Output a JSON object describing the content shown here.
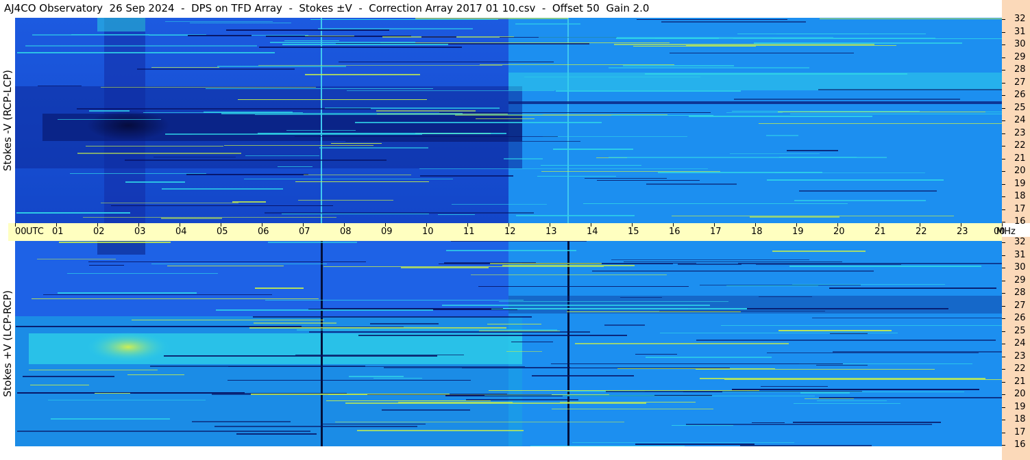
{
  "header": {
    "title": "AJ4CO Observatory  26 Sep 2024  -  DPS on TFD Array  -  Stokes ±V  -  Correction Array 2017 01 10.csv  -  Offset 50  Gain 2.0"
  },
  "panels": {
    "top_label": "Stokes -V (RCP-LCP)",
    "bottom_label": "Stokes +V (LCP-RCP)"
  },
  "colors": {
    "background_low": "#061060",
    "background_mid": "#1a4fe0",
    "background_high": "#1b9ef0",
    "activity": "#2fd3e8",
    "burst": "#c8f04a",
    "time_axis_bg": "#ffffc0",
    "freq_axis_bg": "#fbd9b9"
  },
  "chart_data": {
    "type": "heatmap",
    "x_unit": "UTC",
    "y_unit": "MHz",
    "x_ticks": [
      "00",
      "01",
      "02",
      "03",
      "04",
      "05",
      "06",
      "07",
      "08",
      "09",
      "10",
      "11",
      "12",
      "13",
      "14",
      "15",
      "16",
      "17",
      "18",
      "19",
      "20",
      "21",
      "22",
      "23",
      "00"
    ],
    "x_range_hours": [
      0,
      24
    ],
    "y_ticks": [
      "16",
      "17",
      "18",
      "19",
      "20",
      "21",
      "22",
      "23",
      "24",
      "25",
      "26",
      "27",
      "28",
      "29",
      "30",
      "31",
      "32"
    ],
    "y_range_mhz": [
      16,
      32
    ],
    "panels": [
      {
        "name": "Stokes -V (RCP-LCP)"
      },
      {
        "name": "Stokes +V (LCP-RCP)"
      }
    ]
  }
}
